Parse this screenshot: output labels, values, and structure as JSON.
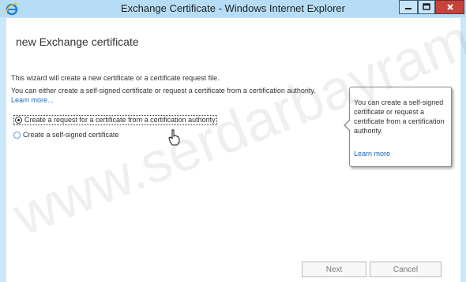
{
  "window": {
    "title": "Exchange Certificate - Windows Internet Explorer",
    "icon": "internet-explorer-icon"
  },
  "page": {
    "title": "new Exchange certificate",
    "intro_line1": "This wizard will create a new certificate or a certificate request file.",
    "intro_line2": "You can either create a self-signed certificate or request a certificate from a certification authority.",
    "learn_more": "Learn more..."
  },
  "options": [
    {
      "label": "Create a request for a certificate from a certification authority",
      "selected": true
    },
    {
      "label": "Create a self-signed certificate",
      "selected": false
    }
  ],
  "tooltip": {
    "text": "You can create a self-signed certificate or request a certificate from a certification authority.",
    "link": "Learn more"
  },
  "buttons": {
    "next": "Next",
    "cancel": "Cancel"
  },
  "watermark": "www.serdarbayram",
  "colors": {
    "titlebar": "#b7ddf6",
    "link": "#1a66b8",
    "close_button": "#c7423a"
  }
}
